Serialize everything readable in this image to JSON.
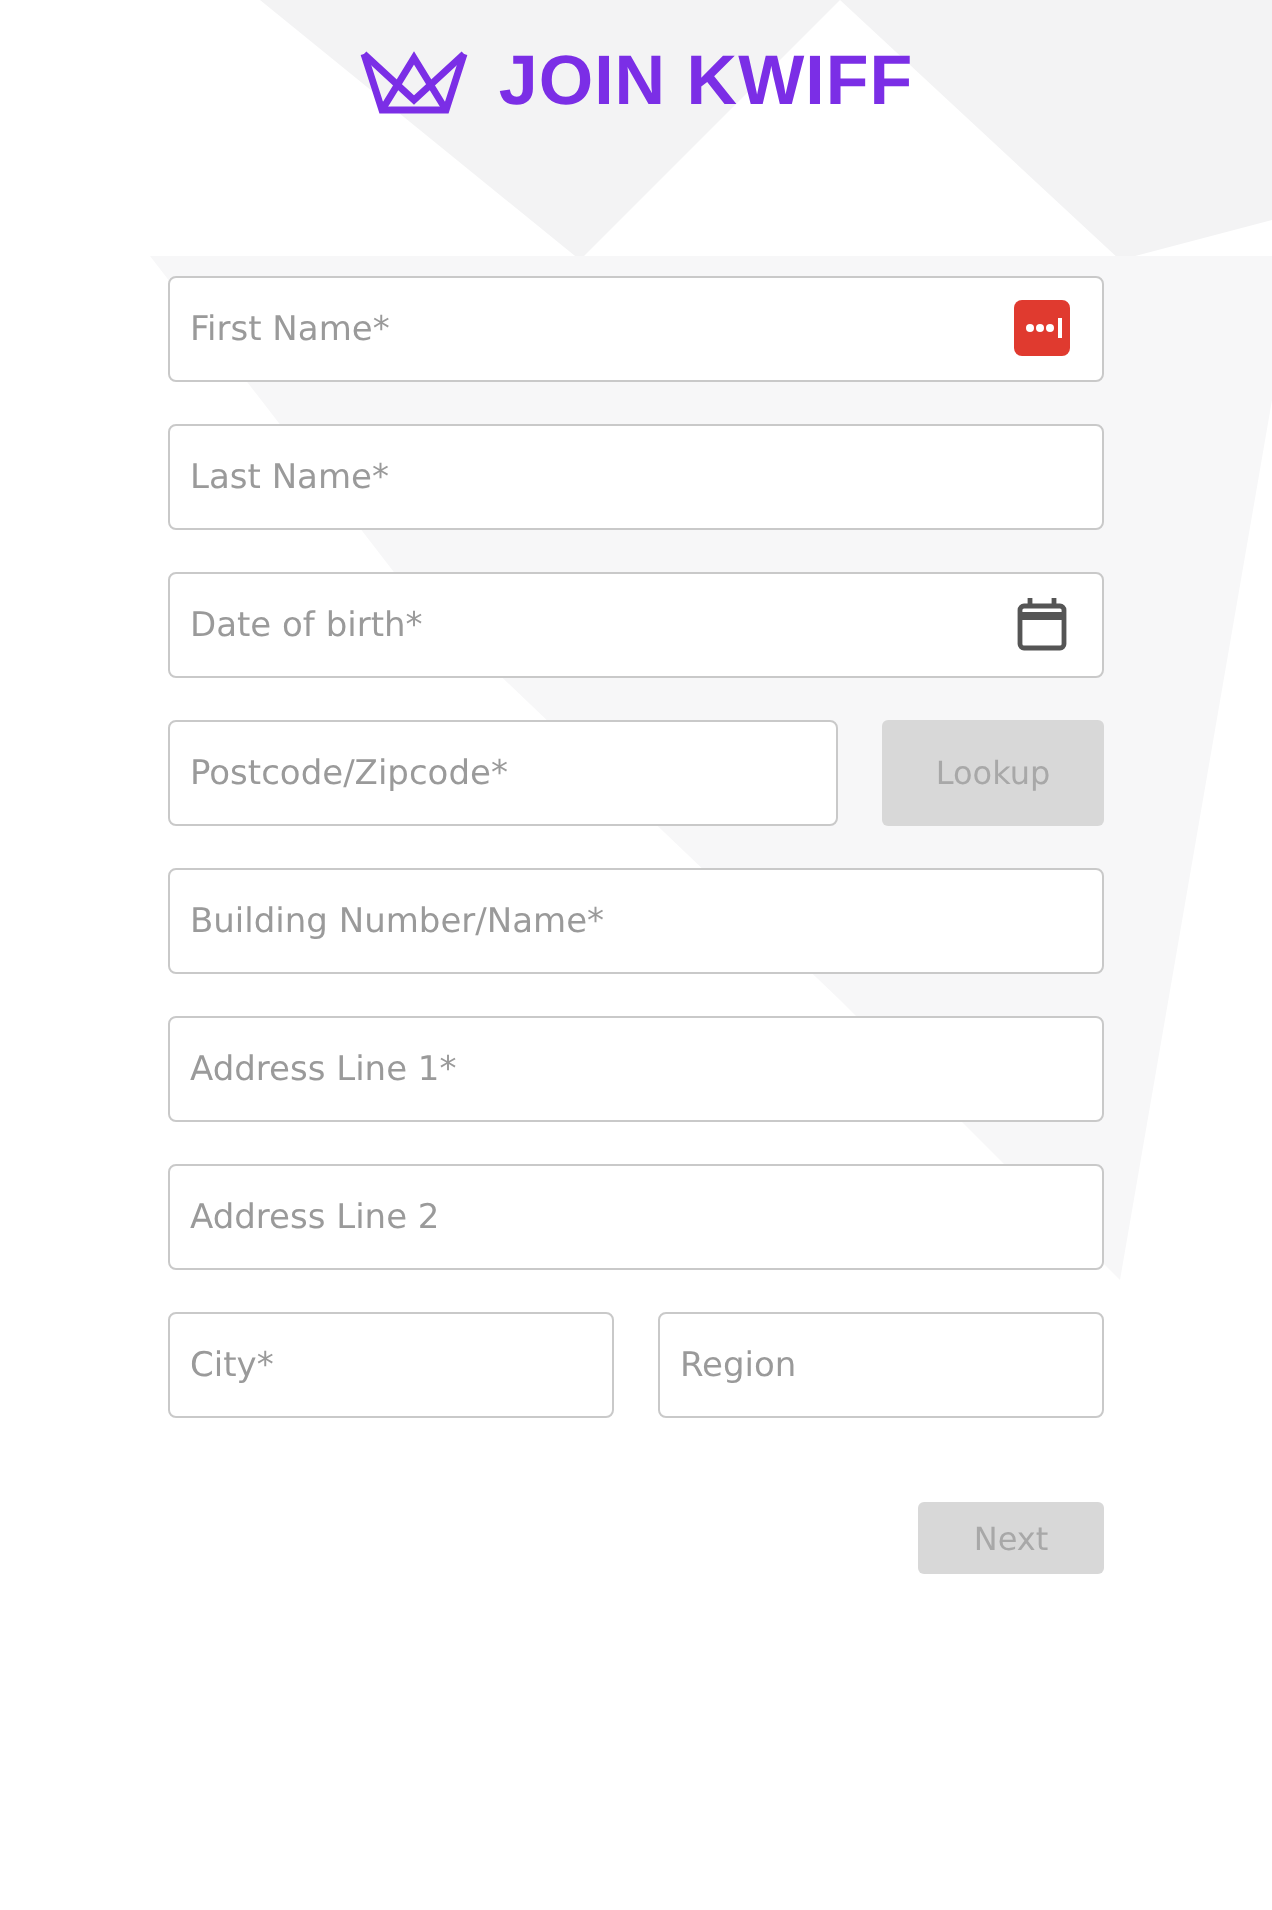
{
  "header": {
    "title": "JOIN KWIFF"
  },
  "rows": [
    {
      "kind": "single",
      "fields": [
        {
          "kind": "autofill",
          "placeholder": "First Name*"
        }
      ]
    },
    {
      "kind": "single",
      "fields": [
        {
          "placeholder": "Last Name*"
        }
      ]
    },
    {
      "kind": "single",
      "fields": [
        {
          "kind": "date",
          "placeholder": "Date of birth*"
        }
      ]
    },
    {
      "kind": "with-button",
      "fields": [
        {
          "placeholder": "Postcode/Zipcode*"
        }
      ],
      "button": {
        "label": "Lookup",
        "disabled": true
      }
    },
    {
      "kind": "single",
      "fields": [
        {
          "placeholder": "Building Number/Name*"
        }
      ]
    },
    {
      "kind": "single",
      "fields": [
        {
          "placeholder": "Address Line 1*"
        }
      ]
    },
    {
      "kind": "single",
      "fields": [
        {
          "placeholder": "Address Line 2"
        }
      ]
    },
    {
      "kind": "pair",
      "fields": [
        {
          "placeholder": "City*"
        },
        {
          "placeholder": "Region"
        }
      ]
    }
  ],
  "next_button": {
    "label": "Next",
    "disabled": true
  }
}
